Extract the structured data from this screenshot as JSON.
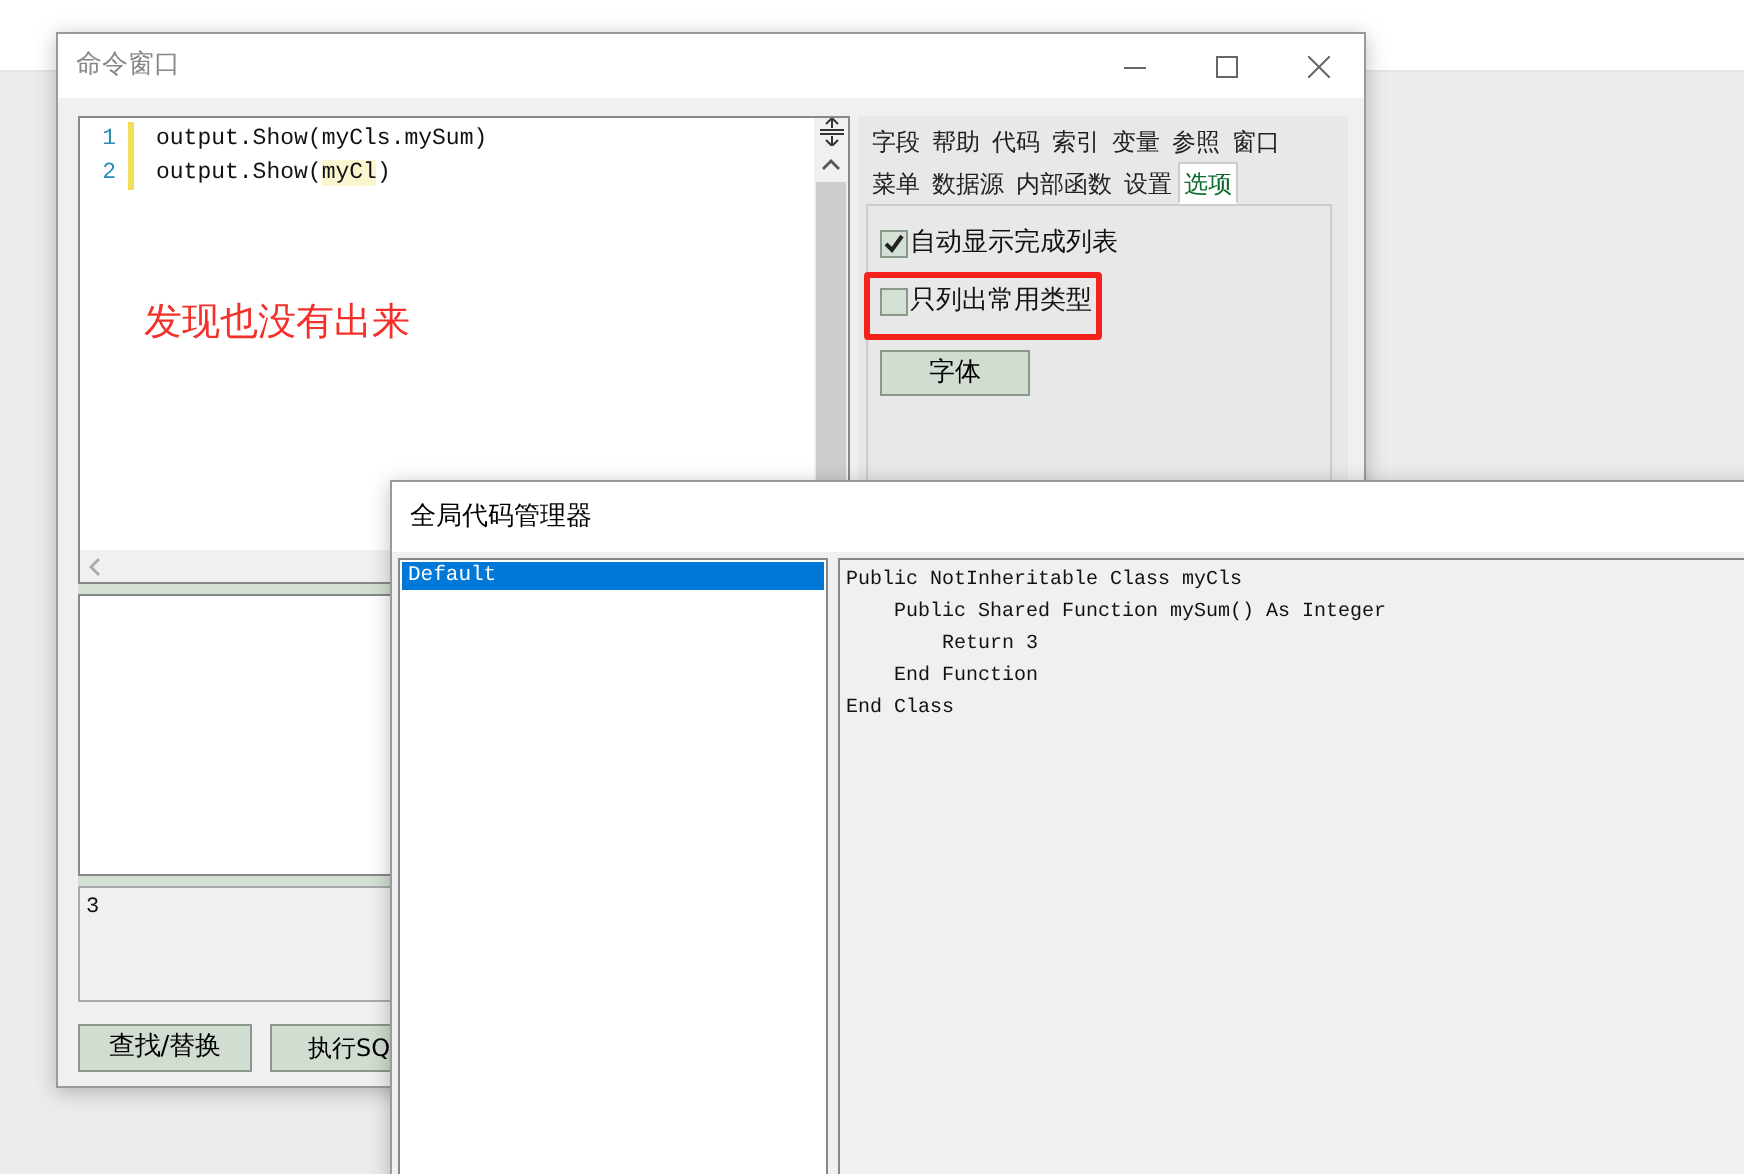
{
  "command_window": {
    "title": "命令窗口",
    "code_lines": [
      {
        "number": "1",
        "segments": [
          {
            "text": "output.Show(myCls.mySum)",
            "highlighted": false
          }
        ]
      },
      {
        "number": "2",
        "segments": [
          {
            "text": "output.Show(",
            "highlighted": false
          },
          {
            "text": "myCl",
            "highlighted": true
          },
          {
            "text": ")",
            "highlighted": false
          }
        ]
      }
    ],
    "tab_rows": [
      [
        {
          "label": "字段",
          "selected": false
        },
        {
          "label": "帮助",
          "selected": false
        },
        {
          "label": "代码",
          "selected": false
        },
        {
          "label": "索引",
          "selected": false
        },
        {
          "label": "变量",
          "selected": false
        },
        {
          "label": "参照",
          "selected": false
        },
        {
          "label": "窗口",
          "selected": false
        }
      ],
      [
        {
          "label": "菜单",
          "selected": false
        },
        {
          "label": "数据源",
          "selected": false
        },
        {
          "label": "内部函数",
          "selected": false
        },
        {
          "label": "设置",
          "selected": false
        },
        {
          "label": "选项",
          "selected": true
        }
      ]
    ],
    "options": [
      {
        "label": "自动显示完成列表",
        "checked": true
      },
      {
        "label": "只列出常用类型",
        "checked": false
      }
    ],
    "font_button": "字体",
    "result": "3",
    "buttons": [
      "查找/替换",
      "执行SQ"
    ]
  },
  "annotation": {
    "text": "发现也没有出来"
  },
  "code_manager": {
    "title": "全局代码管理器",
    "items": [
      {
        "label": "Default",
        "selected": true
      }
    ],
    "code": [
      "Public NotInheritable Class myCls",
      "    Public Shared Function mySum() As Integer",
      "        Return 3",
      "    End Function",
      "End Class"
    ]
  }
}
